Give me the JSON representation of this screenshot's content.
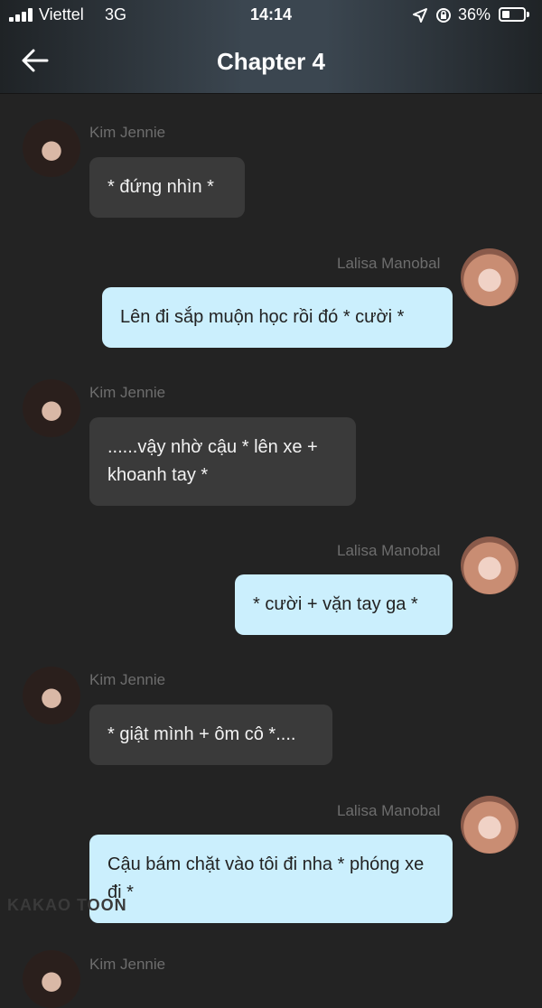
{
  "status_bar": {
    "carrier": "Viettel",
    "network": "3G",
    "time": "14:14",
    "battery_percent": "36%",
    "battery_level": 0.36
  },
  "header": {
    "title": "Chapter 4",
    "back_icon": "arrow-left-icon"
  },
  "messages": [
    {
      "side": "left",
      "sender": "Kim Jennie",
      "text": "* đứng nhìn *"
    },
    {
      "side": "right",
      "sender": "Lalisa Manobal",
      "text": "Lên đi sắp muộn học rồi đó * cười *"
    },
    {
      "side": "left",
      "sender": "Kim Jennie",
      "text": "......vậy nhờ cậu * lên xe + khoanh tay *"
    },
    {
      "side": "right",
      "sender": "Lalisa Manobal",
      "text": "* cười + vặn tay ga *"
    },
    {
      "side": "left",
      "sender": "Kim Jennie",
      "text": "* giật mình + ôm cô *...."
    },
    {
      "side": "right",
      "sender": "Lalisa Manobal",
      "text": "Cậu bám chặt vào tôi đi nha * phóng xe đi *"
    }
  ],
  "peek": {
    "sender": "Kim Jennie"
  },
  "watermark": "KAKAO TOON",
  "colors": {
    "background": "#232323",
    "left_bubble": "#3a3a3a",
    "right_bubble": "#cbeffd",
    "sender_name": "#6d6d6d"
  }
}
